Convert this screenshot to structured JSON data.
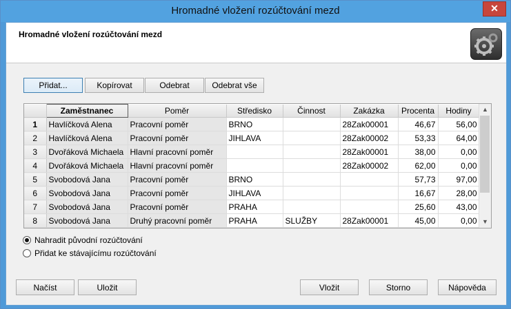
{
  "window": {
    "title": "Hromadné vložení rozúčtování mezd",
    "close_glyph": "✕"
  },
  "header": {
    "title": "Hromadné vložení rozúčtování mezd",
    "logo_icon": "gears-icon"
  },
  "toolbar": {
    "add": "Přidat...",
    "copy": "Kopírovat",
    "remove": "Odebrat",
    "remove_all": "Odebrat vše"
  },
  "grid": {
    "columns": [
      "Zaměstnanec",
      "Poměr",
      "Středisko",
      "Činnost",
      "Zakázka",
      "Procenta",
      "Hodiny"
    ],
    "rows": [
      {
        "n": "1",
        "emp": "Havlíčková Alena",
        "pom": "Pracovní poměr",
        "str": "BRNO",
        "cin": "",
        "zak": "28Zak00001",
        "proc": "46,67",
        "hod": "56,00"
      },
      {
        "n": "2",
        "emp": "Havlíčková Alena",
        "pom": "Pracovní poměr",
        "str": "JIHLAVA",
        "cin": "",
        "zak": "28Zak00002",
        "proc": "53,33",
        "hod": "64,00"
      },
      {
        "n": "3",
        "emp": "Dvořáková Michaela",
        "pom": "Hlavní pracovní poměr",
        "str": "",
        "cin": "",
        "zak": "28Zak00001",
        "proc": "38,00",
        "hod": "0,00"
      },
      {
        "n": "4",
        "emp": "Dvořáková Michaela",
        "pom": "Hlavní pracovní poměr",
        "str": "",
        "cin": "",
        "zak": "28Zak00002",
        "proc": "62,00",
        "hod": "0,00"
      },
      {
        "n": "5",
        "emp": "Svobodová Jana",
        "pom": "Pracovní poměr",
        "str": "BRNO",
        "cin": "",
        "zak": "",
        "proc": "57,73",
        "hod": "97,00"
      },
      {
        "n": "6",
        "emp": "Svobodová Jana",
        "pom": "Pracovní poměr",
        "str": "JIHLAVA",
        "cin": "",
        "zak": "",
        "proc": "16,67",
        "hod": "28,00"
      },
      {
        "n": "7",
        "emp": "Svobodová Jana",
        "pom": "Pracovní poměr",
        "str": "PRAHA",
        "cin": "",
        "zak": "",
        "proc": "25,60",
        "hod": "43,00"
      },
      {
        "n": "8",
        "emp": "Svobodová Jana",
        "pom": "Druhý pracovní poměr",
        "str": "PRAHA",
        "cin": "SLUŽBY",
        "zak": "28Zak00001",
        "proc": "45,00",
        "hod": "0,00"
      }
    ]
  },
  "options": {
    "replace": "Nahradit původní rozúčtování",
    "append": "Přidat ke stávajícímu rozúčtování",
    "selected": "replace"
  },
  "footer": {
    "load": "Načíst",
    "save": "Uložit",
    "insert": "Vložit",
    "cancel": "Storno",
    "help": "Nápověda"
  }
}
